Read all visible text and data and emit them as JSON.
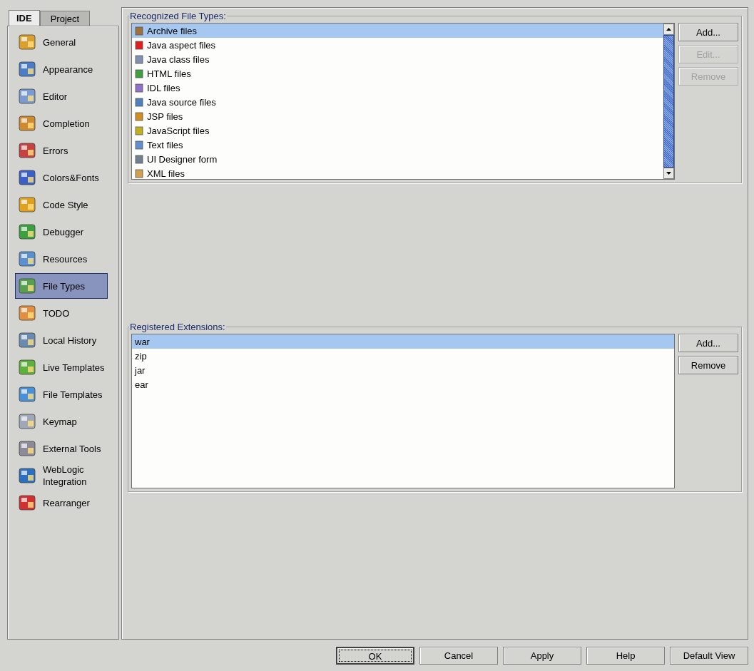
{
  "tabs": [
    {
      "label": "IDE",
      "selected": true
    },
    {
      "label": "Project",
      "selected": false
    }
  ],
  "sidebar": {
    "items": [
      {
        "label": "General",
        "selected": false
      },
      {
        "label": "Appearance",
        "selected": false
      },
      {
        "label": "Editor",
        "selected": false
      },
      {
        "label": "Completion",
        "selected": false
      },
      {
        "label": "Errors",
        "selected": false
      },
      {
        "label": "Colors&Fonts",
        "selected": false
      },
      {
        "label": "Code Style",
        "selected": false
      },
      {
        "label": "Debugger",
        "selected": false
      },
      {
        "label": "Resources",
        "selected": false
      },
      {
        "label": "File Types",
        "selected": true
      },
      {
        "label": "TODO",
        "selected": false
      },
      {
        "label": "Local History",
        "selected": false
      },
      {
        "label": "Live Templates",
        "selected": false
      },
      {
        "label": "File Templates",
        "selected": false
      },
      {
        "label": "Keymap",
        "selected": false
      },
      {
        "label": "External Tools",
        "selected": false
      },
      {
        "label": "WebLogic Integration",
        "selected": false
      },
      {
        "label": "Rearranger",
        "selected": false
      }
    ]
  },
  "recognized_file_types": {
    "title": "Recognized File Types:",
    "items": [
      {
        "label": "Archive files",
        "selected": true,
        "color": "#a0703a"
      },
      {
        "label": "Java aspect files",
        "selected": false,
        "color": "#e02020"
      },
      {
        "label": "Java class files",
        "selected": false,
        "color": "#8090b0"
      },
      {
        "label": "HTML files",
        "selected": false,
        "color": "#40a040"
      },
      {
        "label": "IDL files",
        "selected": false,
        "color": "#9070c8"
      },
      {
        "label": "Java source files",
        "selected": false,
        "color": "#5080c0"
      },
      {
        "label": "JSP files",
        "selected": false,
        "color": "#d09020"
      },
      {
        "label": "JavaScript files",
        "selected": false,
        "color": "#c0b020"
      },
      {
        "label": "Text files",
        "selected": false,
        "color": "#6090d0"
      },
      {
        "label": "UI Designer form",
        "selected": false,
        "color": "#708090"
      },
      {
        "label": "XML files",
        "selected": false,
        "color": "#d0a050"
      }
    ],
    "buttons": [
      {
        "label": "Add...",
        "disabled": false
      },
      {
        "label": "Edit...",
        "disabled": true
      },
      {
        "label": "Remove",
        "disabled": true
      }
    ]
  },
  "registered_extensions": {
    "title": "Registered Extensions:",
    "items": [
      {
        "label": "war",
        "selected": true
      },
      {
        "label": "zip",
        "selected": false
      },
      {
        "label": "jar",
        "selected": false
      },
      {
        "label": "ear",
        "selected": false
      }
    ],
    "buttons": [
      {
        "label": "Add...",
        "disabled": false
      },
      {
        "label": "Remove",
        "disabled": false
      }
    ]
  },
  "dialog_buttons": [
    {
      "label": "OK",
      "focused": true
    },
    {
      "label": "Cancel",
      "focused": false
    },
    {
      "label": "Apply",
      "focused": false
    },
    {
      "label": "Help",
      "focused": false
    },
    {
      "label": "Default View",
      "focused": false
    }
  ]
}
